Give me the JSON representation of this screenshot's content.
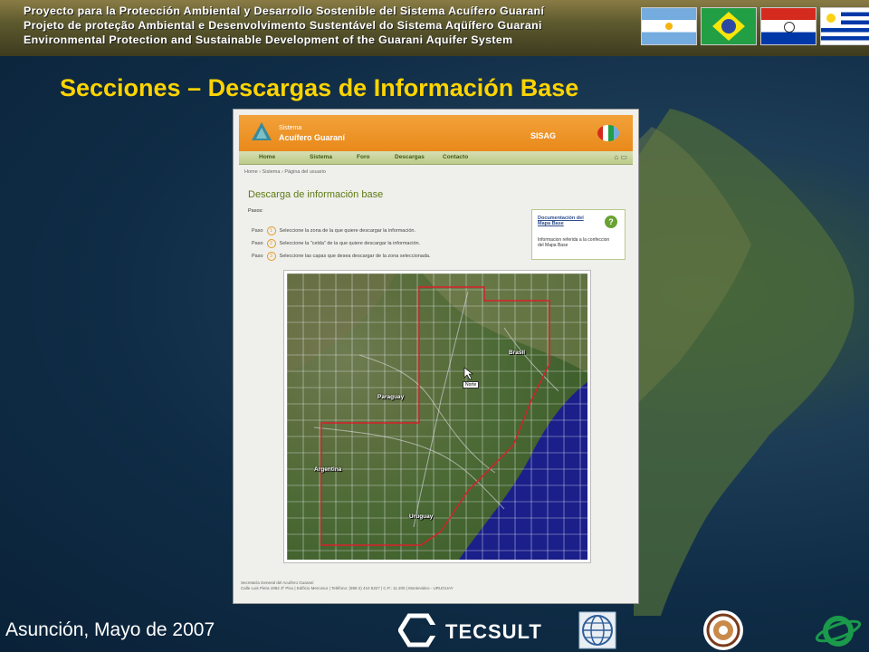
{
  "banner": {
    "lines": [
      "Proyecto para la Protección Ambiental y Desarrollo Sostenible del Sistema Acuífero Guaraní",
      "Projeto de proteção Ambiental e Desenvolvimento Sustentável do Sistema Aqüífero Guarani",
      "Environmental Protection and Sustainable Development of the Guarani Aquifer System"
    ],
    "flags": [
      "argentina-flag",
      "brazil-flag",
      "paraguay-flag",
      "uruguay-flag"
    ]
  },
  "slide_title": "Secciones – Descargas de Información Base",
  "screenshot": {
    "header": {
      "logo_small": "Sistema",
      "logo_big": "Acuífero Guaraní",
      "app_name": "SISAG"
    },
    "nav": [
      "Home",
      "Sistema",
      "Foro",
      "Descargas",
      "Contacto"
    ],
    "breadcrumb": "Home › Sistema › Página del usuario",
    "page_heading": "Descarga de información base",
    "pasos_label": "Pasos:",
    "steps": [
      {
        "label": "Paso",
        "num": "1",
        "text": "Seleccione la zona de la que quiere descargar la información."
      },
      {
        "label": "Paso",
        "num": "2",
        "text": "Seleccione la \"celda\" de la que quiere descargar la información."
      },
      {
        "label": "Paso",
        "num": "3",
        "text": "Seleccione las capas que desea descargar de la zona seleccionada."
      }
    ],
    "doc_box": {
      "title": "Documentación del Mapa Base",
      "desc": "Informacion referida a la confeccion del Mapa Base",
      "help": "?"
    },
    "map": {
      "labels": [
        "Brasil",
        "Paraguay",
        "Argentina",
        "Uruguay"
      ],
      "cursor_label": "Norte"
    },
    "footer": [
      "Secretaría General del Acuífero Guaraní",
      "Calle Luis Piera 1992 3º Piso  |  Edificio Mercosur  |  Teléfono: (598 2) 410 5327  |  C.P.: 11.200  |  Montevideo - URUGUAY"
    ]
  },
  "footer": {
    "place_date": "Asunción, Mayo de 2007",
    "tecsult": "TECSULT"
  },
  "colors": {
    "title": "#ffd400",
    "header_orange": "#e9891a",
    "nav_green": "#bccb88",
    "grid_red": "#d8202a"
  }
}
